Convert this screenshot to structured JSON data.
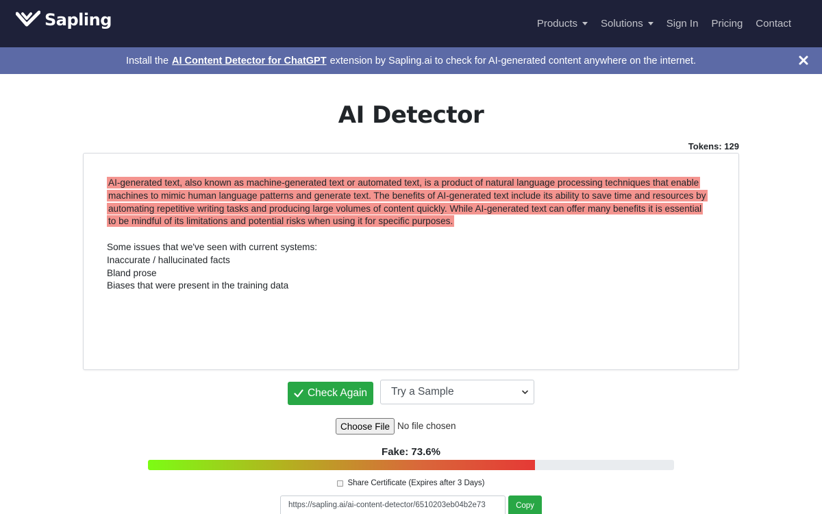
{
  "nav": {
    "brand": "Sapling",
    "links": [
      {
        "label": "Products",
        "dropdown": true
      },
      {
        "label": "Solutions",
        "dropdown": true
      },
      {
        "label": "Sign In"
      },
      {
        "label": "Pricing"
      },
      {
        "label": "Contact"
      }
    ]
  },
  "banner": {
    "prefix": "Install the",
    "link": "AI Content Detector for ChatGPT",
    "suffix": "extension by Sapling.ai to check for AI-generated content anywhere on the internet."
  },
  "main": {
    "title": "AI Detector",
    "tokens_label": "Tokens:",
    "tokens_value": "129",
    "editor": {
      "highlighted_text": "AI-generated text, also known as machine-generated text or automated text, is a product of natural language processing techniques that enable machines to mimic human language patterns and generate text. The benefits of AI-generated text include its ability to save time and resources by automating repetitive writing tasks and producing large volumes of content quickly. While AI-generated text can offer many benefits it is essential to be mindful of its limitations and potential risks when using it for specific purposes.",
      "lines": [
        "Some issues that we've seen with current systems:",
        "Inaccurate / hallucinated facts",
        "Bland prose",
        "Biases that were present in the training data"
      ]
    },
    "check_button": "Check Again",
    "sample_select": "Try a Sample",
    "file": {
      "button": "Choose File",
      "status": "No file chosen"
    },
    "result": {
      "label": "Fake: 73.6%",
      "fake_percent": 73.6
    },
    "share": {
      "label": "Share Certificate (Expires after 3 Days)",
      "url": "https://sapling.ai/ai-content-detector/6510203eb04b2e73",
      "copy_button": "Copy"
    }
  },
  "colors": {
    "navbar_bg": "#1e2139",
    "banner_bg": "#5c6aa6",
    "highlight": "#f4948f",
    "button_green": "#28a745"
  }
}
